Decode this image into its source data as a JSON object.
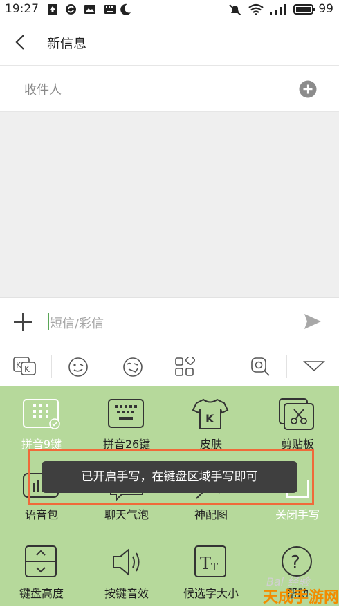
{
  "status_bar": {
    "time": "19:27",
    "battery": "99"
  },
  "header": {
    "title": "新信息"
  },
  "recipient": {
    "label": "收件人"
  },
  "compose": {
    "placeholder": "短信/彩信"
  },
  "keyboard": {
    "row1": [
      "拼音9键",
      "拼音26键",
      "皮肤",
      "剪贴板"
    ],
    "row2": [
      "语音包",
      "聊天气泡",
      "神配图",
      "关闭手写"
    ],
    "row3": [
      "键盘高度",
      "按键音效",
      "候选字大小",
      "帮助"
    ]
  },
  "toast": {
    "text": "已开启手写，在键盘区域手写即可"
  },
  "watermark": {
    "baidu": "Bai 经验",
    "site": "天成手游网"
  },
  "colors": {
    "keyboard_bg": "#b6d99b",
    "toast_bg": "#3f3f3f",
    "highlight": "#f06a3a",
    "accent": "#5aa657"
  }
}
